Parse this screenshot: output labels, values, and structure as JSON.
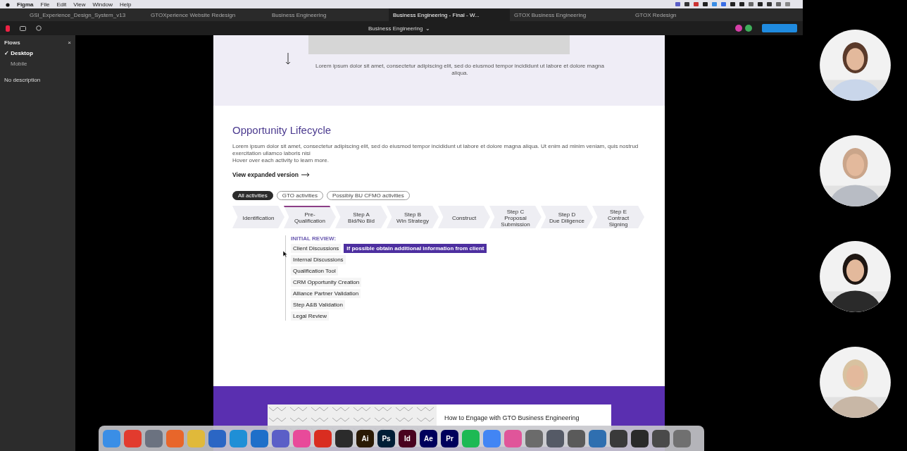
{
  "menu_bar": {
    "app": "Figma",
    "items": [
      "File",
      "Edit",
      "View",
      "Window",
      "Help"
    ]
  },
  "tabs": [
    {
      "label": "GSI_Experience_Design_System_v13",
      "selected": false
    },
    {
      "label": "GTOXperience Website Redesign",
      "selected": false
    },
    {
      "label": "Business Engineering",
      "selected": false
    },
    {
      "label": "Business Engineering - Final - W...",
      "selected": true
    },
    {
      "label": "GTOX Business Engineering",
      "selected": false
    },
    {
      "label": "GTOX Redesign",
      "selected": false
    }
  ],
  "toolbar": {
    "file_title": "Business Engineering",
    "caret": "⌄",
    "avatars": [
      {
        "color": "#d63fa8"
      },
      {
        "color": "#3fae5a"
      }
    ]
  },
  "flows_panel": {
    "title": "Flows",
    "close": "×",
    "flows": [
      {
        "label": "Desktop",
        "selected": true,
        "check": "✓"
      },
      {
        "label": "Mobile",
        "selected": false
      }
    ],
    "description": "No description"
  },
  "page": {
    "hero_text": "Lorem ipsum dolor sit amet, consectetur adipiscing elit, sed do eiusmod tempor incididunt ut labore et dolore magna aliqua.",
    "title": "Opportunity Lifecycle",
    "intro": [
      "Lorem ipsum dolor sit amet, consectetur adipiscing elit, sed do eiusmod tempor incididunt ut labore et dolore magna aliqua. Ut enim ad minim veniam, quis nostrud exercitation ullamco laboris nisi",
      "Hover over each activity to learn more."
    ],
    "link": "View expanded version",
    "filters": [
      {
        "label": "All activities",
        "selected": true
      },
      {
        "label": "GTO activities",
        "selected": false
      },
      {
        "label": "Possibly BU CFMO activities",
        "selected": false
      }
    ],
    "steps": [
      {
        "lines": [
          "Identification"
        ],
        "selected": false
      },
      {
        "lines": [
          "Pre-Qualification"
        ],
        "selected": true
      },
      {
        "lines": [
          "Step A",
          "Bid/No Bid"
        ],
        "selected": false
      },
      {
        "lines": [
          "Step B",
          "Win Strategy"
        ],
        "selected": false
      },
      {
        "lines": [
          "Construct"
        ],
        "selected": false
      },
      {
        "lines": [
          "Step C",
          "Proposal Submission"
        ],
        "selected": false
      },
      {
        "lines": [
          "Step D",
          "Due Diligence"
        ],
        "selected": false
      },
      {
        "lines": [
          "Step E",
          "Contract Signing"
        ],
        "selected": false
      }
    ],
    "activities_heading": "INITIAL REVIEW:",
    "activities": [
      {
        "label": "Client Discussions",
        "tooltip": "If possible obtain additional information from client"
      },
      {
        "label": "Internal Discussions"
      },
      {
        "label": "Qualification Tool"
      },
      {
        "label": "CRM Opportunity Creation"
      },
      {
        "label": "Alliance Partner Validation"
      },
      {
        "label": "Step A&B Validation"
      },
      {
        "label": "Legal Review"
      }
    ],
    "engage_title": "How to Engage with GTO Business Engineering"
  },
  "dock": [
    {
      "color": "#3a8ee6"
    },
    {
      "color": "#e23b2e"
    },
    {
      "color": "#6b7280"
    },
    {
      "color": "#e8662a"
    },
    {
      "color": "#e0b93a"
    },
    {
      "color": "#2b66c4"
    },
    {
      "color": "#1f8fd6"
    },
    {
      "color": "#1e6fc9"
    },
    {
      "color": "#5b5fc7"
    },
    {
      "color": "#e84a9a"
    },
    {
      "color": "#d92d20"
    },
    {
      "color": "#2b2b2b"
    },
    {
      "color": "#2a1a05",
      "label": "Ai"
    },
    {
      "color": "#001e36",
      "label": "Ps"
    },
    {
      "color": "#49021f",
      "label": "Id"
    },
    {
      "color": "#00005b",
      "label": "Ae"
    },
    {
      "color": "#00005b",
      "label": "Pr"
    },
    {
      "color": "#1db954"
    },
    {
      "color": "#4285f4"
    },
    {
      "color": "#e0559a"
    },
    {
      "color": "#6b6b6b"
    },
    {
      "color": "#555a66"
    },
    {
      "color": "#5a5a5a"
    },
    {
      "color": "#2f6fb0"
    },
    {
      "color": "#3a3a3a"
    },
    {
      "color": "#2a2a2a"
    },
    {
      "color": "#4a4a4a"
    },
    {
      "color": "#707070"
    }
  ]
}
